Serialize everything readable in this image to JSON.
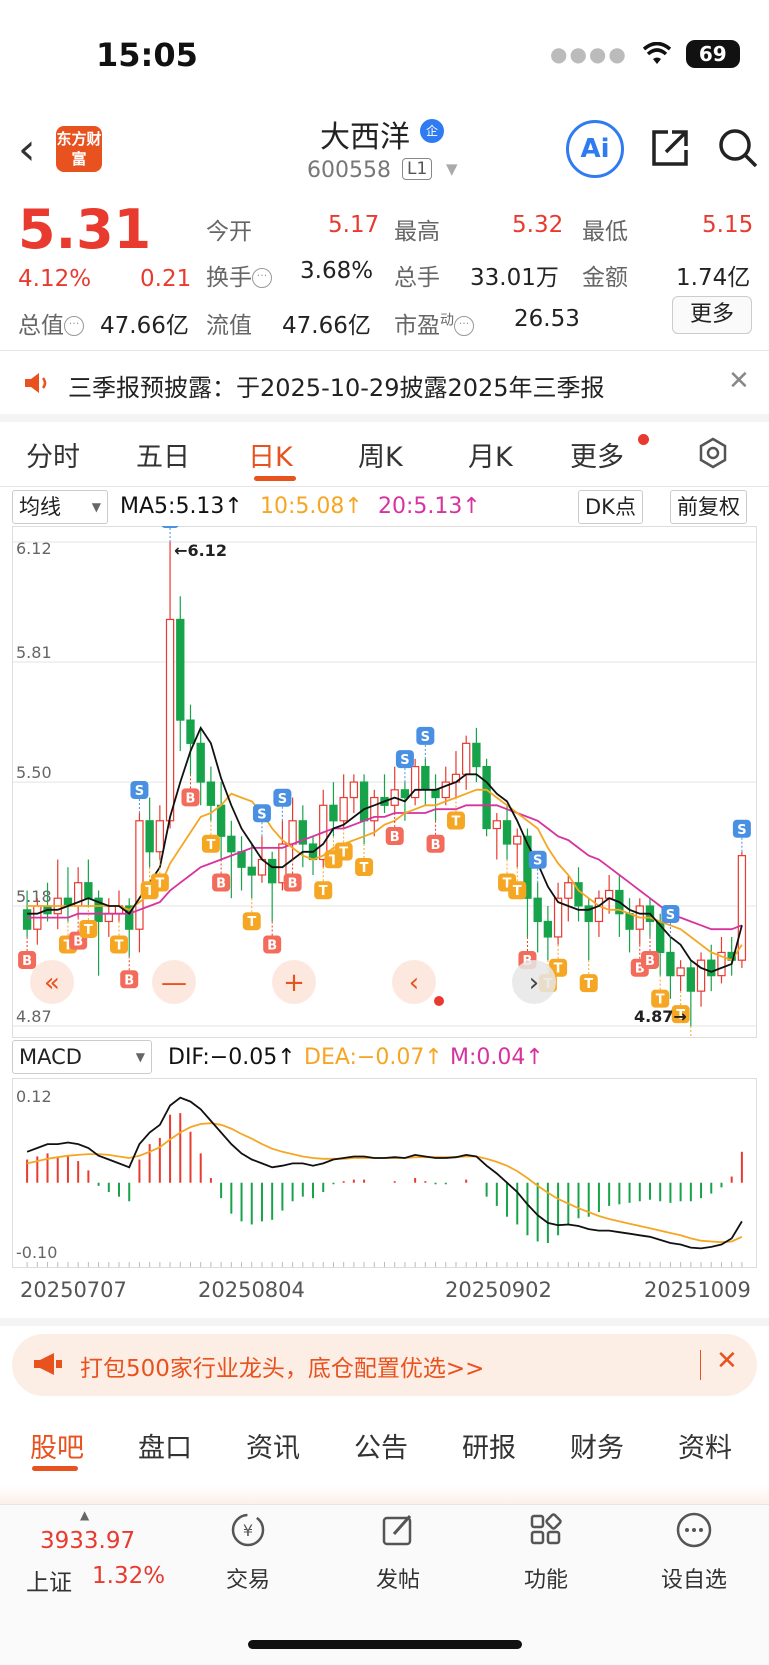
{
  "status": {
    "time": "15:05",
    "battery": "69"
  },
  "header": {
    "logo_text": "东方财富",
    "name": "大西洋",
    "badge": "企",
    "code": "600558",
    "level": "L1",
    "ai_label": "Ai"
  },
  "quote": {
    "price": "5.31",
    "change_pct": "4.12%",
    "change": "0.21",
    "open_label": "今开",
    "open": "5.17",
    "high_label": "最高",
    "high": "5.32",
    "low_label": "最低",
    "low": "5.15",
    "turnover_label": "换手",
    "turnover": "3.68%",
    "volume_label": "总手",
    "volume": "33.01万",
    "amount_label": "金额",
    "amount": "1.74亿",
    "mktcap_label": "总值",
    "mktcap": "47.66亿",
    "float_label": "流值",
    "float": "47.66亿",
    "pe_label": "市盈",
    "pe_sup": "动",
    "pe": "26.53",
    "more_button": "更多"
  },
  "notice": {
    "text": "三季报预披露：于2025-10-29披露2025年三季报"
  },
  "tabs": [
    "分时",
    "五日",
    "日K",
    "周K",
    "月K",
    "更多"
  ],
  "chart_controls": {
    "indicator": "均线",
    "ma5": "MA5:5.13↑",
    "ma10": "10:5.08↑",
    "ma20": "20:5.13↑",
    "dk_button": "DK点",
    "adjust_button": "前复权",
    "macd_select": "MACD",
    "dif": "DIF:−0.05↑",
    "dea": "DEA:−0.07↑",
    "m": "M:0.04↑"
  },
  "colors": {
    "up": "#e83a2f",
    "down": "#16a34a",
    "ma5": "#111111",
    "ma10": "#f5a623",
    "ma20": "#d6339e",
    "accent": "#e8521f",
    "signal_blue": "#4a90e2"
  },
  "chart_data": [
    {
      "type": "candlestick",
      "title": "日K",
      "y_labels": [
        "6.12",
        "5.81",
        "5.50",
        "5.18",
        "4.87"
      ],
      "ylim": [
        4.87,
        6.12
      ],
      "max_label": "←6.12",
      "min_label": "4.87→",
      "dates": [
        "20250707",
        "20250804",
        "20250902",
        "20251009"
      ],
      "candles": [
        [
          5.17,
          5.12,
          5.22,
          5.1
        ],
        [
          5.12,
          5.18,
          5.2,
          5.08
        ],
        [
          5.18,
          5.16,
          5.24,
          5.14
        ],
        [
          5.16,
          5.2,
          5.3,
          5.12
        ],
        [
          5.2,
          5.18,
          5.28,
          5.14
        ],
        [
          5.18,
          5.24,
          5.28,
          5.15
        ],
        [
          5.24,
          5.2,
          5.3,
          5.18
        ],
        [
          5.2,
          5.14,
          5.22,
          5.0
        ],
        [
          5.14,
          5.16,
          5.2,
          5.1
        ],
        [
          5.16,
          5.18,
          5.22,
          5.14
        ],
        [
          5.18,
          5.12,
          5.2,
          5.05
        ],
        [
          5.12,
          5.4,
          5.42,
          5.06
        ],
        [
          5.4,
          5.32,
          5.46,
          5.28
        ],
        [
          5.32,
          5.4,
          5.44,
          5.3
        ],
        [
          5.4,
          5.92,
          6.12,
          5.38
        ],
        [
          5.92,
          5.66,
          5.98,
          5.58
        ],
        [
          5.66,
          5.6,
          5.7,
          5.52
        ],
        [
          5.6,
          5.5,
          5.64,
          5.44
        ],
        [
          5.5,
          5.44,
          5.54,
          5.4
        ],
        [
          5.44,
          5.36,
          5.5,
          5.3
        ],
        [
          5.36,
          5.32,
          5.4,
          5.2
        ],
        [
          5.32,
          5.28,
          5.36,
          5.22
        ],
        [
          5.28,
          5.26,
          5.34,
          5.2
        ],
        [
          5.26,
          5.3,
          5.36,
          5.24
        ],
        [
          5.3,
          5.24,
          5.32,
          5.14
        ],
        [
          5.24,
          5.34,
          5.4,
          5.22
        ],
        [
          5.34,
          5.4,
          5.46,
          5.3
        ],
        [
          5.4,
          5.34,
          5.44,
          5.28
        ],
        [
          5.34,
          5.3,
          5.36,
          5.26
        ],
        [
          5.3,
          5.44,
          5.48,
          5.28
        ],
        [
          5.44,
          5.4,
          5.5,
          5.36
        ],
        [
          5.4,
          5.46,
          5.52,
          5.38
        ],
        [
          5.46,
          5.5,
          5.52,
          5.42
        ],
        [
          5.5,
          5.4,
          5.52,
          5.34
        ],
        [
          5.4,
          5.46,
          5.48,
          5.36
        ],
        [
          5.46,
          5.44,
          5.52,
          5.42
        ],
        [
          5.44,
          5.48,
          5.54,
          5.42
        ],
        [
          5.48,
          5.46,
          5.5,
          5.4
        ],
        [
          5.46,
          5.54,
          5.56,
          5.44
        ],
        [
          5.54,
          5.48,
          5.56,
          5.44
        ],
        [
          5.48,
          5.46,
          5.52,
          5.4
        ],
        [
          5.46,
          5.5,
          5.54,
          5.44
        ],
        [
          5.5,
          5.52,
          5.58,
          5.46
        ],
        [
          5.52,
          5.6,
          5.62,
          5.48
        ],
        [
          5.6,
          5.54,
          5.64,
          5.5
        ],
        [
          5.54,
          5.38,
          5.56,
          5.36
        ],
        [
          5.38,
          5.4,
          5.42,
          5.3
        ],
        [
          5.4,
          5.34,
          5.44,
          5.3
        ],
        [
          5.34,
          5.36,
          5.38,
          5.28
        ],
        [
          5.36,
          5.2,
          5.38,
          5.1
        ],
        [
          5.2,
          5.14,
          5.24,
          5.06
        ],
        [
          5.14,
          5.1,
          5.18,
          5.04
        ],
        [
          5.1,
          5.2,
          5.24,
          5.08
        ],
        [
          5.2,
          5.24,
          5.26,
          5.14
        ],
        [
          5.24,
          5.18,
          5.28,
          5.14
        ],
        [
          5.18,
          5.14,
          5.2,
          5.04
        ],
        [
          5.14,
          5.2,
          5.22,
          5.1
        ],
        [
          5.2,
          5.22,
          5.26,
          5.16
        ],
        [
          5.22,
          5.16,
          5.26,
          5.1
        ],
        [
          5.16,
          5.12,
          5.2,
          5.06
        ],
        [
          5.12,
          5.18,
          5.2,
          5.08
        ],
        [
          5.18,
          5.14,
          5.2,
          5.1
        ],
        [
          5.14,
          5.06,
          5.16,
          5.0
        ],
        [
          5.06,
          5.0,
          5.1,
          4.94
        ],
        [
          5.0,
          5.02,
          5.04,
          4.96
        ],
        [
          5.02,
          4.96,
          5.04,
          4.87
        ],
        [
          4.96,
          5.04,
          5.06,
          4.92
        ],
        [
          5.04,
          5.0,
          5.08,
          4.96
        ],
        [
          5.0,
          5.06,
          5.1,
          4.98
        ],
        [
          5.06,
          5.04,
          5.1,
          5.0
        ],
        [
          5.04,
          5.31,
          5.32,
          5.02
        ]
      ],
      "ma5": [
        5.16,
        5.16,
        5.17,
        5.17,
        5.18,
        5.19,
        5.2,
        5.19,
        5.18,
        5.18,
        5.16,
        5.2,
        5.24,
        5.28,
        5.41,
        5.5,
        5.58,
        5.64,
        5.6,
        5.51,
        5.44,
        5.38,
        5.34,
        5.3,
        5.28,
        5.28,
        5.3,
        5.32,
        5.32,
        5.34,
        5.38,
        5.39,
        5.41,
        5.43,
        5.44,
        5.45,
        5.46,
        5.45,
        5.48,
        5.48,
        5.48,
        5.49,
        5.5,
        5.52,
        5.52,
        5.5,
        5.47,
        5.45,
        5.4,
        5.34,
        5.29,
        5.23,
        5.19,
        5.18,
        5.17,
        5.17,
        5.18,
        5.2,
        5.19,
        5.17,
        5.16,
        5.16,
        5.13,
        5.1,
        5.08,
        5.04,
        5.02,
        5.01,
        5.02,
        5.03,
        5.13
      ],
      "ma10": [
        5.18,
        5.18,
        5.18,
        5.18,
        5.18,
        5.18,
        5.18,
        5.18,
        5.18,
        5.18,
        5.17,
        5.19,
        5.21,
        5.23,
        5.29,
        5.33,
        5.37,
        5.41,
        5.42,
        5.44,
        5.47,
        5.46,
        5.45,
        5.42,
        5.38,
        5.35,
        5.33,
        5.31,
        5.3,
        5.31,
        5.33,
        5.34,
        5.35,
        5.36,
        5.37,
        5.39,
        5.4,
        5.42,
        5.43,
        5.44,
        5.44,
        5.45,
        5.46,
        5.47,
        5.48,
        5.48,
        5.46,
        5.44,
        5.42,
        5.4,
        5.38,
        5.33,
        5.29,
        5.26,
        5.22,
        5.2,
        5.18,
        5.17,
        5.17,
        5.16,
        5.15,
        5.15,
        5.14,
        5.13,
        5.12,
        5.1,
        5.08,
        5.06,
        5.05,
        5.04,
        5.08
      ],
      "ma20": [
        5.15,
        5.15,
        5.15,
        5.15,
        5.15,
        5.16,
        5.16,
        5.16,
        5.16,
        5.16,
        5.16,
        5.17,
        5.18,
        5.19,
        5.22,
        5.24,
        5.26,
        5.28,
        5.29,
        5.3,
        5.31,
        5.32,
        5.33,
        5.33,
        5.33,
        5.33,
        5.34,
        5.35,
        5.36,
        5.37,
        5.38,
        5.38,
        5.39,
        5.4,
        5.41,
        5.41,
        5.42,
        5.42,
        5.42,
        5.42,
        5.43,
        5.43,
        5.43,
        5.44,
        5.44,
        5.44,
        5.44,
        5.43,
        5.42,
        5.41,
        5.4,
        5.38,
        5.36,
        5.35,
        5.33,
        5.31,
        5.3,
        5.28,
        5.26,
        5.24,
        5.22,
        5.2,
        5.18,
        5.16,
        5.15,
        5.14,
        5.13,
        5.12,
        5.12,
        5.12,
        5.13
      ],
      "signals": [
        {
          "i": 0,
          "t": "B"
        },
        {
          "i": 4,
          "t": "T"
        },
        {
          "i": 5,
          "t": "B"
        },
        {
          "i": 6,
          "t": "T"
        },
        {
          "i": 9,
          "t": "T"
        },
        {
          "i": 10,
          "t": "B"
        },
        {
          "i": 11,
          "t": "S"
        },
        {
          "i": 12,
          "t": "T"
        },
        {
          "i": 13,
          "t": "T"
        },
        {
          "i": 14,
          "t": "S"
        },
        {
          "i": 16,
          "t": "B"
        },
        {
          "i": 18,
          "t": "T"
        },
        {
          "i": 19,
          "t": "B"
        },
        {
          "i": 22,
          "t": "T"
        },
        {
          "i": 23,
          "t": "S"
        },
        {
          "i": 24,
          "t": "B"
        },
        {
          "i": 25,
          "t": "S"
        },
        {
          "i": 26,
          "t": "B"
        },
        {
          "i": 29,
          "t": "T"
        },
        {
          "i": 30,
          "t": "T"
        },
        {
          "i": 31,
          "t": "T"
        },
        {
          "i": 33,
          "t": "T"
        },
        {
          "i": 36,
          "t": "B"
        },
        {
          "i": 37,
          "t": "S"
        },
        {
          "i": 39,
          "t": "S"
        },
        {
          "i": 40,
          "t": "B"
        },
        {
          "i": 42,
          "t": "T"
        },
        {
          "i": 47,
          "t": "T"
        },
        {
          "i": 48,
          "t": "T"
        },
        {
          "i": 49,
          "t": "B"
        },
        {
          "i": 50,
          "t": "S"
        },
        {
          "i": 51,
          "t": "T"
        },
        {
          "i": 52,
          "t": "T"
        },
        {
          "i": 55,
          "t": "T"
        },
        {
          "i": 60,
          "t": "B"
        },
        {
          "i": 61,
          "t": "B"
        },
        {
          "i": 62,
          "t": "T"
        },
        {
          "i": 63,
          "t": "S"
        },
        {
          "i": 64,
          "t": "T"
        },
        {
          "i": 65,
          "t": "T"
        },
        {
          "i": 70,
          "t": "S"
        }
      ]
    },
    {
      "type": "macd",
      "y_labels": [
        "0.12",
        "-0.10"
      ],
      "ylim": [
        -0.1,
        0.12
      ],
      "dif": [
        0.04,
        0.045,
        0.05,
        0.05,
        0.052,
        0.05,
        0.045,
        0.035,
        0.03,
        0.025,
        0.02,
        0.05,
        0.065,
        0.075,
        0.1,
        0.11,
        0.105,
        0.095,
        0.08,
        0.065,
        0.05,
        0.038,
        0.03,
        0.025,
        0.02,
        0.022,
        0.025,
        0.025,
        0.022,
        0.025,
        0.03,
        0.032,
        0.034,
        0.034,
        0.032,
        0.032,
        0.033,
        0.032,
        0.036,
        0.034,
        0.032,
        0.032,
        0.033,
        0.036,
        0.034,
        0.022,
        0.012,
        0.0,
        -0.012,
        -0.028,
        -0.042,
        -0.052,
        -0.055,
        -0.054,
        -0.056,
        -0.06,
        -0.062,
        -0.062,
        -0.064,
        -0.066,
        -0.068,
        -0.07,
        -0.074,
        -0.078,
        -0.08,
        -0.084,
        -0.085,
        -0.083,
        -0.08,
        -0.072,
        -0.05
      ],
      "dea": [
        0.025,
        0.028,
        0.031,
        0.033,
        0.035,
        0.036,
        0.037,
        0.037,
        0.036,
        0.034,
        0.032,
        0.035,
        0.04,
        0.046,
        0.056,
        0.065,
        0.072,
        0.076,
        0.077,
        0.075,
        0.07,
        0.063,
        0.057,
        0.05,
        0.044,
        0.04,
        0.037,
        0.034,
        0.032,
        0.031,
        0.031,
        0.031,
        0.032,
        0.032,
        0.032,
        0.032,
        0.032,
        0.032,
        0.033,
        0.033,
        0.033,
        0.033,
        0.033,
        0.034,
        0.034,
        0.031,
        0.027,
        0.022,
        0.015,
        0.006,
        -0.004,
        -0.013,
        -0.021,
        -0.027,
        -0.033,
        -0.038,
        -0.043,
        -0.047,
        -0.05,
        -0.053,
        -0.056,
        -0.059,
        -0.062,
        -0.065,
        -0.068,
        -0.072,
        -0.075,
        -0.076,
        -0.077,
        -0.076,
        -0.07
      ],
      "hist": [
        0.03,
        0.034,
        0.038,
        0.034,
        0.034,
        0.028,
        0.016,
        -0.004,
        -0.012,
        -0.018,
        -0.024,
        0.03,
        0.05,
        0.058,
        0.088,
        0.09,
        0.066,
        0.038,
        0.006,
        -0.02,
        -0.04,
        -0.05,
        -0.054,
        -0.05,
        -0.048,
        -0.036,
        -0.024,
        -0.018,
        -0.02,
        -0.012,
        -0.002,
        0.002,
        0.004,
        0.004,
        0.0,
        0.0,
        0.002,
        0.0,
        0.006,
        0.002,
        -0.002,
        -0.002,
        0.0,
        0.004,
        0.0,
        -0.018,
        -0.03,
        -0.044,
        -0.054,
        -0.068,
        -0.076,
        -0.078,
        -0.068,
        -0.054,
        -0.046,
        -0.044,
        -0.038,
        -0.03,
        -0.028,
        -0.026,
        -0.024,
        -0.022,
        -0.024,
        -0.026,
        -0.024,
        -0.024,
        -0.02,
        -0.014,
        -0.006,
        0.008,
        0.04
      ]
    }
  ],
  "promo": {
    "text": "打包500家行业龙头，底仓配置优选>>"
  },
  "bottom_tabs": [
    "股吧",
    "盘口",
    "资讯",
    "公告",
    "研报",
    "财务",
    "资料"
  ],
  "bottom_nav": {
    "index_value": "3933.97",
    "index_name": "上证",
    "index_change": "1.32%",
    "trade": "交易",
    "post": "发帖",
    "functions": "功能",
    "watchlist": "设自选"
  }
}
